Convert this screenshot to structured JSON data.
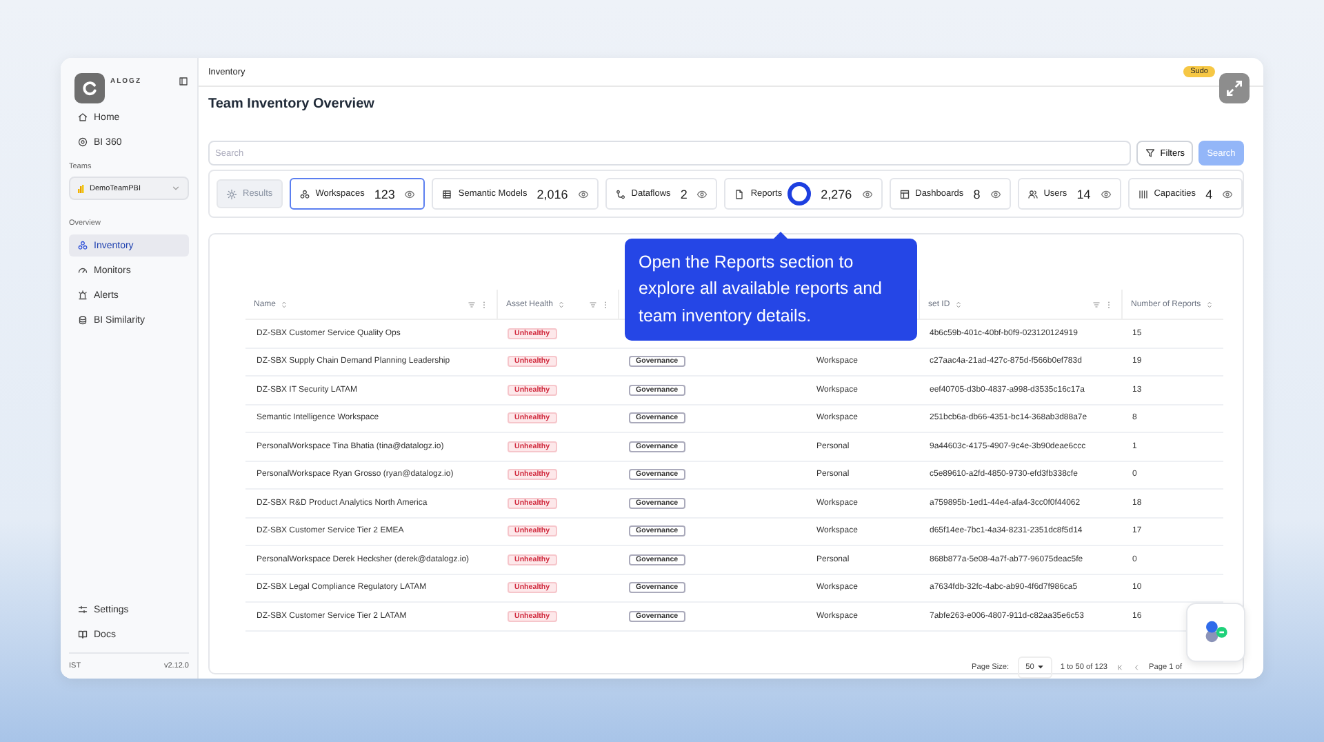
{
  "sidebar": {
    "logo": "ALOGZ",
    "nav": [
      {
        "label": "Home",
        "selected": false
      },
      {
        "label": "BI 360",
        "selected": false
      }
    ],
    "teams_label": "Teams",
    "team_select": "DemoTeamPBI",
    "overview_label": "Overview",
    "overview": [
      {
        "label": "Inventory",
        "selected": true
      },
      {
        "label": "Monitors",
        "selected": false
      },
      {
        "label": "Alerts",
        "selected": false
      },
      {
        "label": "BI Similarity",
        "selected": false
      }
    ],
    "bottom": [
      {
        "label": "Settings"
      },
      {
        "label": "Docs"
      }
    ],
    "footer": {
      "timezone": "IST",
      "version": "v2.12.0"
    }
  },
  "topbar": {
    "breadcrumb": "Inventory",
    "badge": "Sudo"
  },
  "title": "Team Inventory Overview",
  "search": {
    "placeholder": "Search",
    "filters_button": "Filters",
    "search_button": {
      "label": "Search",
      "disabled": true
    }
  },
  "results_button": {
    "label": "Results",
    "disabled": true
  },
  "tabs": [
    {
      "label": "Workspaces",
      "count": "123",
      "selected": true
    },
    {
      "label": "Semantic Models",
      "count": "2,016",
      "selected": false
    },
    {
      "label": "Dataflows",
      "count": "2",
      "selected": false
    },
    {
      "label": "Reports",
      "count": "2,276",
      "selected": false
    },
    {
      "label": "Dashboards",
      "count": "8",
      "selected": false
    },
    {
      "label": "Users",
      "count": "14",
      "selected": false
    },
    {
      "label": "Capacities",
      "count": "4",
      "selected": false
    }
  ],
  "tooltip": "Open the Reports section to explore all available reports and team inventory details.",
  "table": {
    "columns": [
      "Name",
      "Asset Health",
      "set ID",
      "Number of Reports"
    ],
    "rows": [
      {
        "name": "DZ-SBX Customer Service Quality Ops",
        "health": "Unhealthy",
        "asset_id": "4b6c59b-401c-40bf-b0f9-023120124919",
        "reports": "15"
      },
      {
        "name": "DZ-SBX Supply Chain Demand Planning Leadership",
        "health": "Unhealthy",
        "tag": "Governance",
        "type": "Workspace",
        "asset_id": "c27aac4a-21ad-427c-875d-f566b0ef783d",
        "reports": "19"
      },
      {
        "name": "DZ-SBX IT Security LATAM",
        "health": "Unhealthy",
        "tag": "Governance",
        "type": "Workspace",
        "asset_id": "eef40705-d3b0-4837-a998-d3535c16c17a",
        "reports": "13"
      },
      {
        "name": "Semantic Intelligence Workspace",
        "health": "Unhealthy",
        "tag": "Governance",
        "type": "Workspace",
        "asset_id": "251bcb6a-db66-4351-bc14-368ab3d88a7e",
        "reports": "8"
      },
      {
        "name": "PersonalWorkspace Tina Bhatia (tina@datalogz.io)",
        "health": "Unhealthy",
        "tag": "Governance",
        "type": "Personal",
        "asset_id": "9a44603c-4175-4907-9c4e-3b90deae6ccc",
        "reports": "1"
      },
      {
        "name": "PersonalWorkspace Ryan Grosso (ryan@datalogz.io)",
        "health": "Unhealthy",
        "tag": "Governance",
        "type": "Personal",
        "asset_id": "c5e89610-a2fd-4850-9730-efd3fb338cfe",
        "reports": "0"
      },
      {
        "name": "DZ-SBX R&D Product Analytics North America",
        "health": "Unhealthy",
        "tag": "Governance",
        "type": "Workspace",
        "asset_id": "a759895b-1ed1-44e4-afa4-3cc0f0f44062",
        "reports": "18"
      },
      {
        "name": "DZ-SBX Customer Service Tier 2 EMEA",
        "health": "Unhealthy",
        "tag": "Governance",
        "type": "Workspace",
        "asset_id": "d65f14ee-7bc1-4a34-8231-2351dc8f5d14",
        "reports": "17"
      },
      {
        "name": "PersonalWorkspace Derek Hecksher (derek@datalogz.io)",
        "health": "Unhealthy",
        "tag": "Governance",
        "type": "Personal",
        "asset_id": "868b877a-5e08-4a7f-ab77-96075deac5fe",
        "reports": "0"
      },
      {
        "name": "DZ-SBX Legal Compliance Regulatory LATAM",
        "health": "Unhealthy",
        "tag": "Governance",
        "type": "Workspace",
        "asset_id": "a7634fdb-32fc-4abc-ab90-4f6d7f986ca5",
        "reports": "10"
      },
      {
        "name": "DZ-SBX Customer Service Tier 2 LATAM",
        "health": "Unhealthy",
        "tag": "Governance",
        "type": "Workspace",
        "asset_id": "7abfe263-e006-4807-911d-c82aa35e6c53",
        "reports": "16"
      }
    ]
  },
  "pagination": {
    "page_size_label": "Page Size:",
    "page_size": "50",
    "range": "1 to 50 of 123",
    "page": "Page 1 of"
  }
}
